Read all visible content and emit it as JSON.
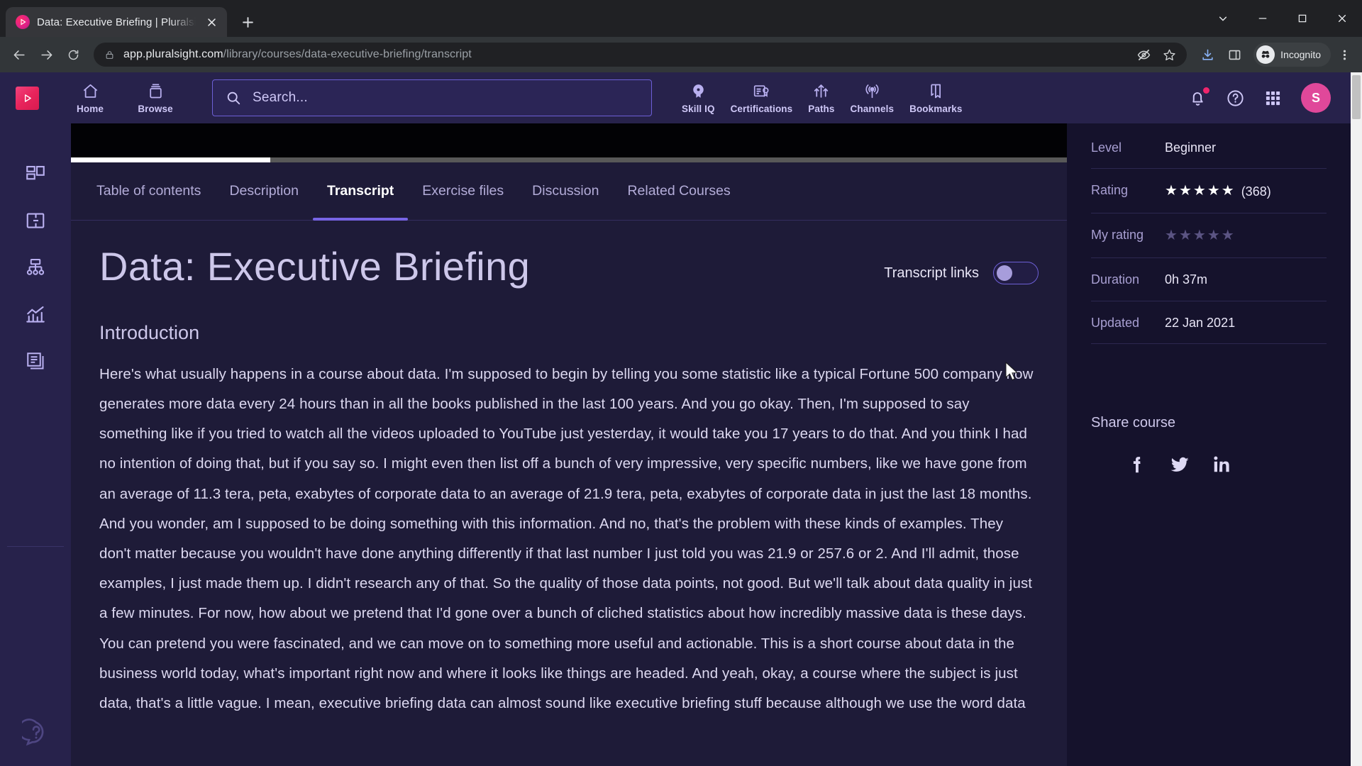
{
  "browser": {
    "tab": {
      "title": "Data: Executive Briefing | Pluralsight",
      "favicon": "pluralsight-favicon",
      "close_label": "Close tab"
    },
    "new_tab_label": "New tab",
    "window_controls": {
      "minimize": "Minimize",
      "maximize": "Maximize",
      "close": "Close",
      "collapse": "Collapse"
    },
    "nav": {
      "back": "Back",
      "forward": "Forward",
      "reload": "Reload"
    },
    "omnibox": {
      "lock": "site-information-lock",
      "url_host": "app.pluralsight.com",
      "url_path": "/library/courses/data-executive-briefing/transcript"
    },
    "actions": {
      "tracking_protection": "tracking-protection-off",
      "bookmark": "Bookmark this tab",
      "downloads": "Downloads",
      "side_panel": "Side panel",
      "profile_label": "Incognito",
      "menu": "Customize and control Google Chrome"
    },
    "scrollbar": {
      "position": "top"
    }
  },
  "app_header": {
    "logo": "pluralsight-logo",
    "nav_left": [
      {
        "label": "Home",
        "icon": "home-icon"
      },
      {
        "label": "Browse",
        "icon": "browse-icon"
      }
    ],
    "search": {
      "placeholder": "Search...",
      "value": "",
      "icon": "search-icon"
    },
    "nav_mid": [
      {
        "label": "Skill IQ",
        "icon": "skill-iq-icon"
      },
      {
        "label": "Certifications",
        "icon": "certifications-icon"
      },
      {
        "label": "Paths",
        "icon": "paths-icon"
      },
      {
        "label": "Channels",
        "icon": "channels-icon"
      },
      {
        "label": "Bookmarks",
        "icon": "bookmarks-icon"
      }
    ],
    "nav_right": {
      "notifications": {
        "icon": "bell-icon",
        "has_badge": true
      },
      "help": {
        "icon": "help-circle-icon"
      },
      "apps": {
        "icon": "grid-apps-icon"
      },
      "avatar": {
        "initial": "S"
      }
    }
  },
  "left_rail": {
    "items": [
      {
        "icon": "dashboard-icon",
        "label": "Dashboard"
      },
      {
        "icon": "flashcard-icon",
        "label": "Skills"
      },
      {
        "icon": "org-chart-icon",
        "label": "Paths"
      },
      {
        "icon": "analytics-icon",
        "label": "Analytics"
      },
      {
        "icon": "library-icon",
        "label": "Library"
      }
    ],
    "help": {
      "icon": "help-chat-icon",
      "label": "Help"
    }
  },
  "player": {
    "progress_percent": 20
  },
  "tabs": [
    {
      "label": "Table of contents",
      "active": false
    },
    {
      "label": "Description",
      "active": false
    },
    {
      "label": "Transcript",
      "active": true
    },
    {
      "label": "Exercise files",
      "active": false
    },
    {
      "label": "Discussion",
      "active": false
    },
    {
      "label": "Related Courses",
      "active": false
    }
  ],
  "main": {
    "course_title": "Data: Executive Briefing",
    "transcript_links": {
      "label": "Transcript links",
      "enabled": false
    },
    "section_heading": "Introduction",
    "transcript_text": "Here's what usually happens in a course about data. I'm supposed to begin by telling you some statistic like a typical Fortune 500 company now generates more data every 24 hours than in all the books published in the last 100 years. And you go okay. Then, I'm supposed to say something like if you tried to watch all the videos uploaded to YouTube just yesterday, it would take you 17 years to do that. And you think I had no intention of doing that, but if you say so. I might even then list off a bunch of very impressive, very specific numbers, like we have gone from an average of 11.3 tera, peta, exabytes of corporate data to an average of 21.9 tera, peta, exabytes of corporate data in just the last 18 months. And you wonder, am I supposed to be doing something with this information. And no, that's the problem with these kinds of examples. They don't matter because you wouldn't have done anything differently if that last number I just told you was 21.9 or 257.6 or 2. And I'll admit, those examples, I just made them up. I didn't research any of that. So the quality of those data points, not good. But we'll talk about data quality in just a few minutes. For now, how about we pretend that I'd gone over a bunch of cliched statistics about how incredibly massive data is these days. You can pretend you were fascinated, and we can move on to something more useful and actionable. This is a short course about data in the business world today, what's important right now and where it looks like things are headed. And yeah, okay, a course where the subject is just data, that's a little vague. I mean, executive briefing data can almost sound like executive briefing stuff because although we use the word data"
  },
  "aside": {
    "meta": [
      {
        "key": "Level",
        "value": "Beginner",
        "type": "text"
      },
      {
        "key": "Rating",
        "value": "(368)",
        "type": "stars",
        "filled": 5,
        "total": 5
      },
      {
        "key": "My rating",
        "value": "",
        "type": "stars-empty",
        "filled": 0,
        "total": 5
      },
      {
        "key": "Duration",
        "value": "0h 37m",
        "type": "text"
      },
      {
        "key": "Updated",
        "value": "22 Jan 2021",
        "type": "text"
      }
    ],
    "share": {
      "heading": "Share course",
      "networks": [
        {
          "name": "facebook-icon",
          "label": "Facebook"
        },
        {
          "name": "twitter-icon",
          "label": "Twitter"
        },
        {
          "name": "linkedin-icon",
          "label": "LinkedIn"
        }
      ]
    }
  },
  "colors": {
    "header_bg": "#27224b",
    "page_bg": "#1e1b38",
    "aside_bg": "#15122c",
    "accent": "#7764e4",
    "brand_pink": "#e8245c",
    "avatar_pink": "#e0489a",
    "nav_text": "#cfc8f7"
  }
}
